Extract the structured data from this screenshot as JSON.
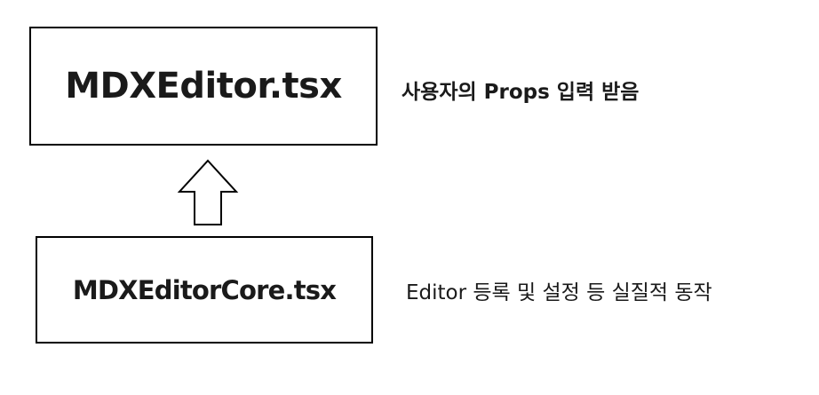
{
  "diagram": {
    "parent_box": {
      "label": "MDXEditor.tsx",
      "description": "사용자의 Props 입력 받음"
    },
    "child_box": {
      "label": "MDXEditorCore.tsx",
      "description": "Editor 등록 및 설정 등 실질적 동작"
    },
    "arrow": {
      "direction": "up",
      "style": "hollow",
      "icon": "hollow-up-arrow-icon"
    },
    "colors": {
      "background": "#ffffff",
      "stroke": "#000000",
      "text": "#1a1a1a"
    }
  }
}
